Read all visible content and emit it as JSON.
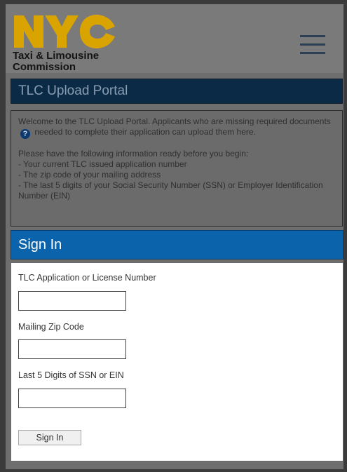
{
  "header": {
    "logo_text": "NYC",
    "org_line1": "Taxi & Limousine",
    "org_line2": "Commission",
    "menu_icon": "hamburger-menu-icon"
  },
  "portal": {
    "title": "TLC Upload Portal"
  },
  "welcome": {
    "text_before_icon": "Welcome to the TLC Upload Portal. Applicants who are missing required documents",
    "help_icon": "question-circle-icon",
    "text_after_icon": "needed to complete their application can upload them here.",
    "ready_heading": "Please have the following information ready before you begin:",
    "items": [
      "- Your current TLC issued application number",
      "- The zip code of your mailing address",
      "- The last 5 digits of your Social Security Number (SSN) or Employer Identification Number (EIN)"
    ]
  },
  "signin": {
    "heading": "Sign In",
    "license_label": "TLC Application or License Number",
    "license_value": "",
    "zip_label": "Mailing Zip Code",
    "zip_value": "",
    "ssn_label": "Last 5 Digits of SSN or EIN",
    "ssn_value": "",
    "button_label": "Sign In"
  },
  "colors": {
    "logo_yellow": "#e0a800",
    "banner_navy": "#0b2a45",
    "signin_blue": "#0a63ab"
  }
}
